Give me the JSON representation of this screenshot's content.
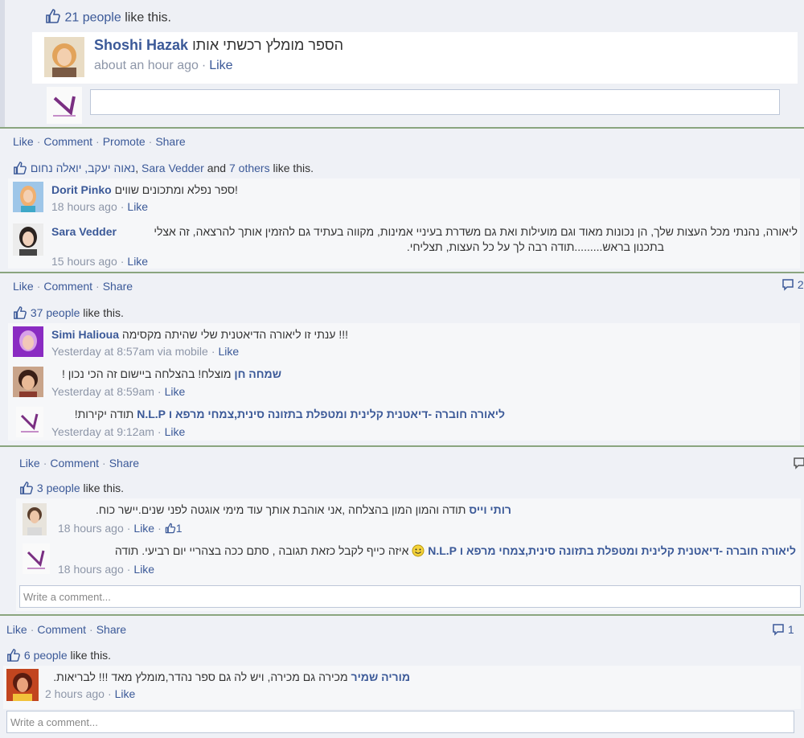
{
  "s1": {
    "likes_count": "21 people",
    "likes_suffix": "like this.",
    "comment": {
      "author": "Shoshi Hazak",
      "text": "הספר מומלץ רכשתי אותו",
      "time": "about an hour ago",
      "like": "Like"
    }
  },
  "s2": {
    "actions": [
      "Like",
      "Comment",
      "Promote",
      "Share"
    ],
    "likes": {
      "names": "נאוה יעקב, יואלה נחום",
      "sep": ",",
      "name2": "Sara Vedder",
      "and": "and",
      "others": "7 others",
      "suffix": "like this."
    },
    "comments": [
      {
        "author": "Dorit Pinko",
        "text": "ספר נפלא ומתכונים שווים!",
        "time": "18 hours ago",
        "like": "Like"
      },
      {
        "author": "Sara Vedder",
        "text1": "ליאורה, נהנתי מכל העצות שלך, הן נכונות מאוד וגם מועילות ואת גם משדרת בעיניי אמינות, מקווה בעתיד גם להזמין אותך להרצאה, זה אצלי",
        "text2": "בתכנון בראש.........תודה רבה לך על כל העצות, תצליחי.",
        "time": "15 hours ago",
        "like": "Like"
      }
    ]
  },
  "s3": {
    "actions": [
      "Like",
      "Comment",
      "Share"
    ],
    "comment_count": "2",
    "likes_count": "37 people",
    "likes_suffix": "like this.",
    "comments": [
      {
        "author": "Simi Halioua",
        "text": "ענתי זו ליאורה הדיאטנית שלי שהיתה מקסימה !!!",
        "time": "Yesterday at 8:57am via mobile",
        "like": "Like"
      },
      {
        "author": "שמחה חן",
        "text": "מוצלח! בהצלחה ביישום זה הכי נכון !",
        "time": "Yesterday at 8:59am",
        "like": "Like"
      },
      {
        "author": "ליאורה חוברה -דיאטנית קלינית ומטפלת בתזונה סינית,צמחי מרפא ו N.L.P",
        "text": "תודה יקירות!",
        "time": "Yesterday at 9:12am",
        "like": "Like"
      }
    ]
  },
  "s4": {
    "actions": [
      "Like",
      "Comment",
      "Share"
    ],
    "likes_count": "3 people",
    "likes_suffix": "like this.",
    "comments": [
      {
        "author": "רותי וייס",
        "text": "תודה והמון המון בהצלחה ,אני אוהבת אותך עוד מימי אוגטה לפני שנים.יישר כוח.",
        "time": "18 hours ago",
        "like": "Like",
        "like_count": "1"
      },
      {
        "author": "ליאורה חוברה -דיאטנית קלינית ומטפלת בתזונה סינית,צמחי מרפא ו N.L.P",
        "text": "איזה כייף לקבל כזאת תגובה , סתם ככה בצהריי יום רביעי. תודה",
        "time": "18 hours ago",
        "like": "Like"
      }
    ],
    "write_placeholder": "Write a comment..."
  },
  "s5": {
    "actions": [
      "Like",
      "Comment",
      "Share"
    ],
    "comment_count": "1",
    "likes_count": "6 people",
    "likes_suffix": "like this.",
    "comment": {
      "author": "מוריה שמיר",
      "text": "מכירה גם מכירה, ויש לה גם ספר נהדר,מומלץ מאד !!! לבריאות.",
      "time": "2 hours ago",
      "like": "Like"
    },
    "write_placeholder": "Write a comment..."
  },
  "colors": {
    "link": "#3b5998",
    "meta": "#8d96a8",
    "separator": "#8aa57f",
    "panel": "#edeff4"
  }
}
